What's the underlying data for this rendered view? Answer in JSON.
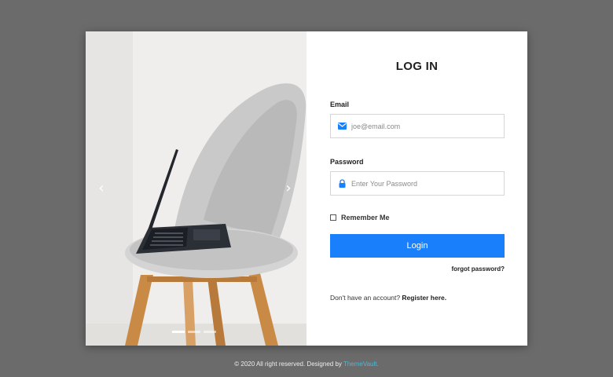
{
  "login": {
    "title": "LOG IN",
    "email_label": "Email",
    "email_placeholder": "joe@email.com",
    "password_label": "Password",
    "password_placeholder": "Enter Your Password",
    "remember_label": "Remember Me",
    "login_button": "Login",
    "forgot_link": "forgot password?",
    "register_prompt": "Don't have an account?",
    "register_link": "Register here."
  },
  "carousel": {
    "prev_icon": "chevron-left-icon",
    "next_icon": "chevron-right-icon",
    "prev_glyph": "‹",
    "next_glyph": "›",
    "slide_count": 3,
    "active_slide": 1
  },
  "footer": {
    "text": "© 2020 All right reserved. Designed by",
    "link": "ThemeVault."
  },
  "colors": {
    "background": "#6b6b6b",
    "primary_button": "#1a7ffb",
    "footer_link": "#4fb7d8",
    "icon_blue": "#1a7ffb"
  }
}
